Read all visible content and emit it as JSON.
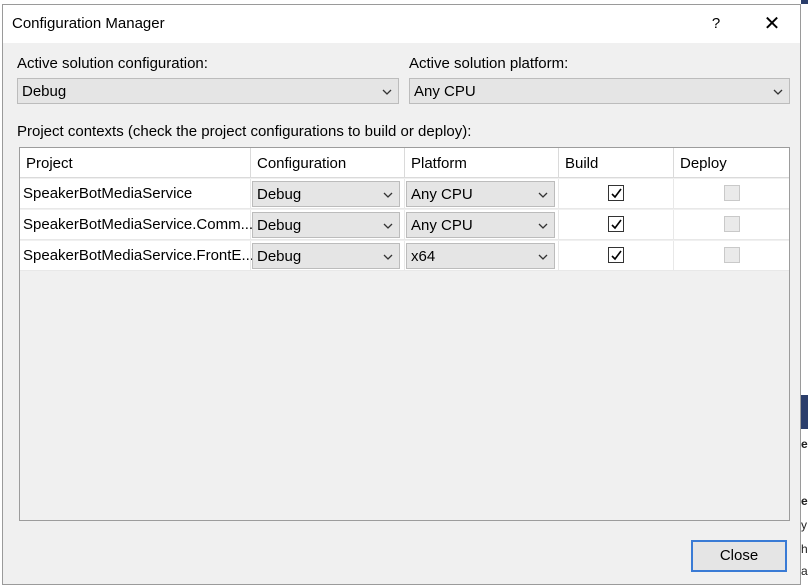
{
  "window": {
    "title": "Configuration Manager",
    "help_label": "?",
    "close_label": "✕"
  },
  "active_config": {
    "label": "Active solution configuration:",
    "value": "Debug"
  },
  "active_platform": {
    "label": "Active solution platform:",
    "value": "Any CPU"
  },
  "contexts_label": "Project contexts (check the project configurations to build or deploy):",
  "columns": [
    "Project",
    "Configuration",
    "Platform",
    "Build",
    "Deploy"
  ],
  "rows": [
    {
      "project": "SpeakerBotMediaService",
      "configuration": "Debug",
      "platform": "Any CPU",
      "build": true,
      "deploy": false
    },
    {
      "project": "SpeakerBotMediaService.Comm...",
      "configuration": "Debug",
      "platform": "Any CPU",
      "build": true,
      "deploy": false
    },
    {
      "project": "SpeakerBotMediaService.FrontE...",
      "configuration": "Debug",
      "platform": "x64",
      "build": true,
      "deploy": false
    }
  ],
  "buttons": {
    "close": "Close"
  },
  "background_edge": {
    "letters": [
      "e",
      "e",
      "y",
      "h",
      "a"
    ]
  },
  "colors": {
    "accent": "#3a7bd5",
    "dialog_bg": "#f0f0f0"
  }
}
